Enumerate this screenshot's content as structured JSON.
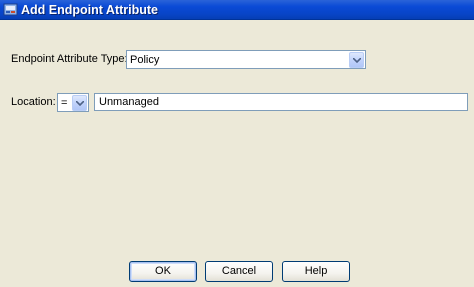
{
  "window": {
    "title": "Add Endpoint Attribute",
    "icon": "asdm-app-icon"
  },
  "form": {
    "attribute_type_label": "Endpoint Attribute Type:",
    "attribute_type_value": "Policy",
    "location_label": "Location:",
    "operator_value": "=",
    "location_value": "Unmanaged"
  },
  "buttons": {
    "ok": "OK",
    "cancel": "Cancel",
    "help": "Help"
  },
  "colors": {
    "titlebar": "#0a4ad6",
    "window_background": "#ece9d8",
    "field_border": "#7f9db9"
  }
}
